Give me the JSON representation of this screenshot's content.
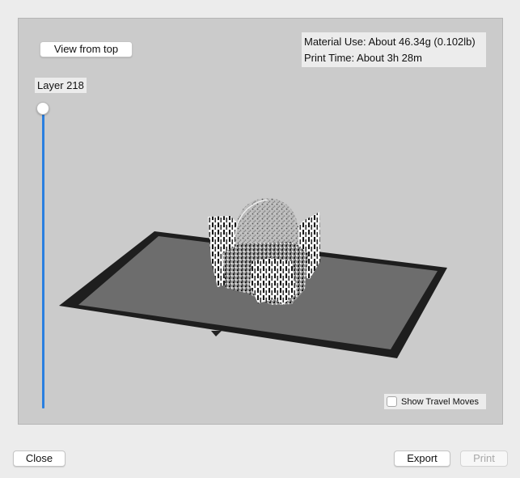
{
  "viewport": {
    "view_from_top_label": "View from top",
    "material_use": "Material Use: About 46.34g (0.102lb)",
    "print_time": "Print Time: About 3h 28m",
    "layer_label": "Layer 218",
    "show_travel_moves_label": "Show Travel Moves",
    "show_travel_moves_checked": false
  },
  "footer": {
    "close_label": "Close",
    "export_label": "Export",
    "print_label": "Print",
    "print_enabled": false
  },
  "colors": {
    "slider_accent": "#2a7fe0",
    "bed_surface": "#6e6e6e",
    "bed_border": "#1e1e1e",
    "viewport_background": "#cbcbcb"
  },
  "icons": {
    "model_preview": "toolpath-model-preview",
    "build_plate": "build-plate"
  }
}
